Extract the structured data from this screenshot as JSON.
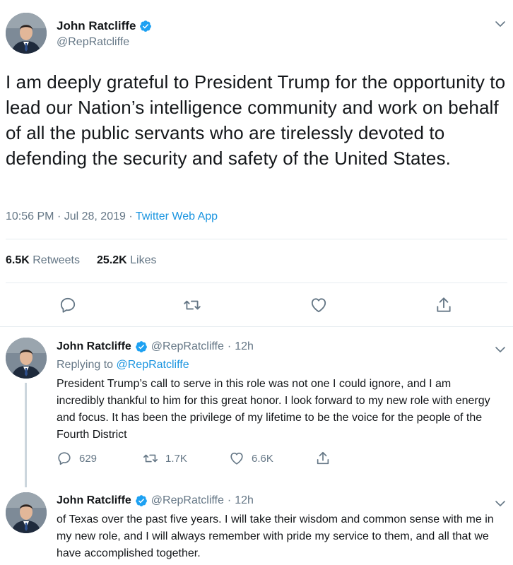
{
  "main_tweet": {
    "author_name": "John Ratcliffe",
    "author_handle": "@RepRatcliffe",
    "text": "I am deeply grateful to President Trump for the opportunity to lead our Nation’s intelligence community and work on behalf of all the public servants who are tirelessly devoted to defending the security and safety of the United States.",
    "time": "10:56 PM",
    "date": "Jul 28, 2019",
    "separator": "·",
    "source": "Twitter Web App",
    "retweets_count": "6.5K",
    "retweets_label": "Retweets",
    "likes_count": "25.2K",
    "likes_label": "Likes"
  },
  "replies": [
    {
      "author_name": "John Ratcliffe",
      "author_handle": "@RepRatcliffe",
      "dot": "·",
      "time_ago": "12h",
      "replying_prefix": "Replying to",
      "replying_to": "@RepRatcliffe",
      "text": "President Trump’s call to serve in this role was not one I could ignore, and I am incredibly thankful to him for this great honor. I look forward to my new role with energy and focus. It has been the privilege of my lifetime to be the voice for the people of the Fourth District",
      "reply_count": "629",
      "retweet_count": "1.7K",
      "like_count": "6.6K"
    },
    {
      "author_name": "John Ratcliffe",
      "author_handle": "@RepRatcliffe",
      "dot": "·",
      "time_ago": "12h",
      "text": "of Texas over the past five years. I will take their wisdom and common sense with me in my new role, and I will always remember with pride my service to them, and all that we have accomplished together."
    }
  ],
  "icons": {
    "verified": "verified-badge-icon",
    "chevron": "chevron-down-icon",
    "reply": "reply-icon",
    "retweet": "retweet-icon",
    "like": "heart-icon",
    "share": "share-icon"
  },
  "colors": {
    "text": "#14171a",
    "secondary": "#657786",
    "link": "#1b95e0",
    "divider": "#e6ecf0",
    "thread_line": "#ccd6dd"
  }
}
